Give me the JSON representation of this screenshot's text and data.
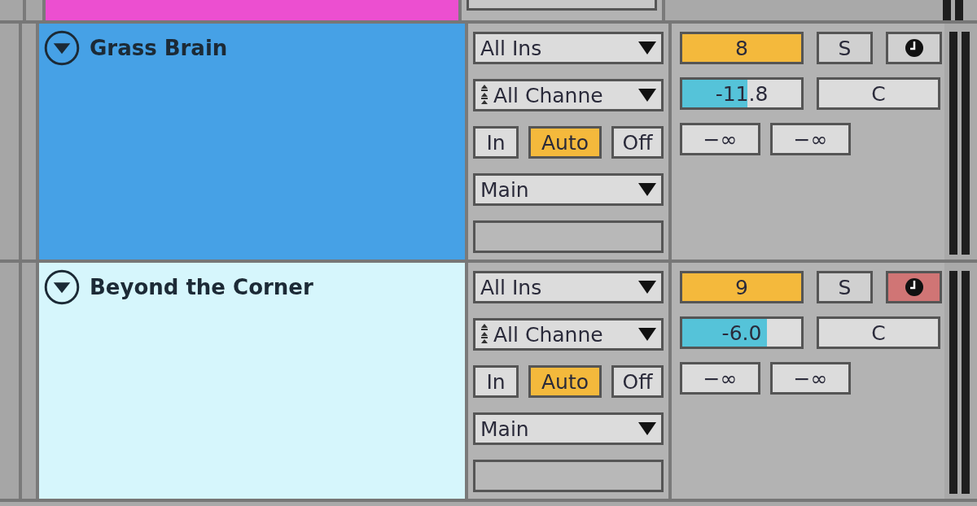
{
  "tracks": [
    {
      "kind": "partial",
      "color": "#ec4fd0"
    },
    {
      "kind": "full",
      "name": "Grass Brain",
      "color": "#46a1e6",
      "expanded": true,
      "input_type": "All Ins",
      "input_channel": "All Channe",
      "monitor": [
        {
          "label": "In",
          "selected": false
        },
        {
          "label": "Auto",
          "selected": true
        },
        {
          "label": "Off",
          "selected": false
        }
      ],
      "output": "Main",
      "number": "8",
      "active": true,
      "solo": {
        "label": "S",
        "on": false
      },
      "arm": false,
      "volume": {
        "reading": "-11.8",
        "level": 0.55
      },
      "pan": "C",
      "sends": [
        "−∞",
        "−∞"
      ]
    },
    {
      "kind": "full",
      "name": "Beyond the Corner",
      "color": "#d6f6fc",
      "expanded": true,
      "input_type": "All Ins",
      "input_channel": "All Channe",
      "monitor": [
        {
          "label": "In",
          "selected": false
        },
        {
          "label": "Auto",
          "selected": true
        },
        {
          "label": "Off",
          "selected": false
        }
      ],
      "output": "Main",
      "number": "9",
      "active": true,
      "solo": {
        "label": "S",
        "on": false
      },
      "arm": true,
      "volume": {
        "reading": "-6.0",
        "level": 0.71
      },
      "pan": "C",
      "sends": [
        "−∞",
        "−∞"
      ]
    }
  ]
}
